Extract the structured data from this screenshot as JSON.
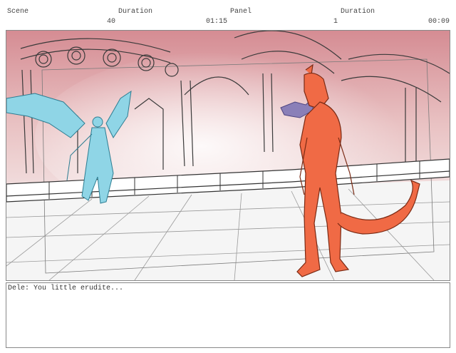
{
  "header": {
    "scene_label": "Scene",
    "duration_label_1": "Duration",
    "panel_label": "Panel",
    "duration_label_2": "Duration",
    "scene_value": "40",
    "duration_value_1": "01:15",
    "panel_value": "1",
    "duration_value_2": "00:09"
  },
  "panel": {
    "sky_color": "#d99a9f",
    "floor_color": "#f4f4f4",
    "blue_character_color": "#8fd5e6",
    "red_character_color": "#f06a45",
    "purple_creature_color": "#8a7fb8"
  },
  "caption": {
    "text": "Dele: You little erudite..."
  }
}
